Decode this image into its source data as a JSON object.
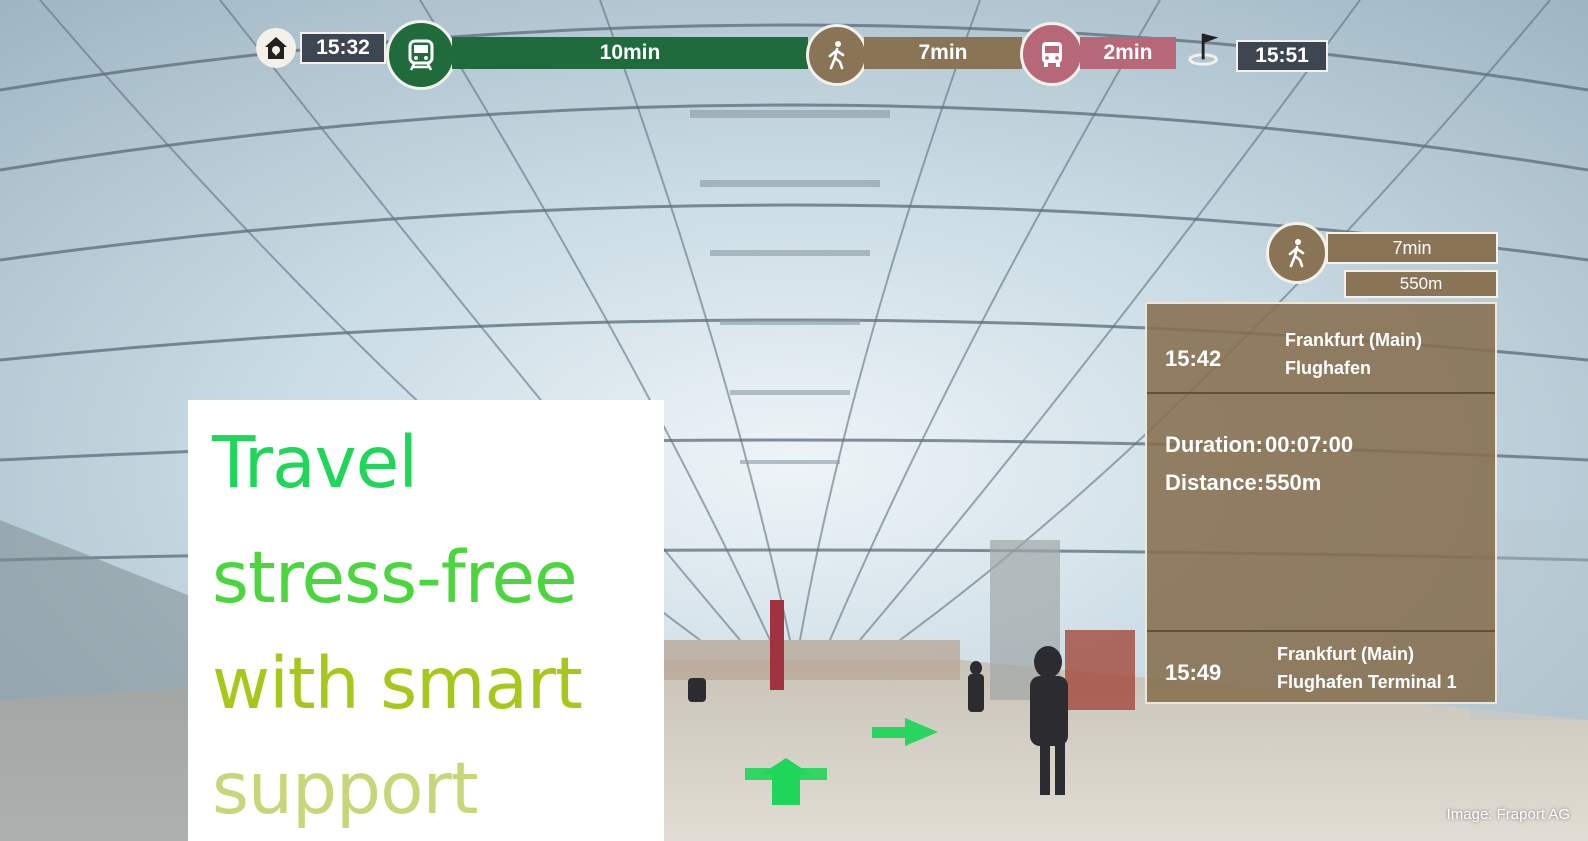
{
  "journey_bar": {
    "start_time": "15:32",
    "train_duration": "10min",
    "walk_duration": "7min",
    "bus_duration": "2min",
    "end_time": "15:51"
  },
  "walk_panel": {
    "walk_time": "7min",
    "walk_distance": "550m",
    "departure_time": "15:42",
    "departure_station_line1": "Frankfurt (Main)",
    "departure_station_line2": "Flughafen",
    "duration_label": "Duration:",
    "duration_value": "00:07:00",
    "distance_label": "Distance:",
    "distance_value": "550m",
    "arrival_time": "15:49",
    "arrival_station_line1": "Frankfurt (Main)",
    "arrival_station_line2": "Flughafen Terminal 1"
  },
  "headline": {
    "line1": "Travel",
    "line2": "stress-free",
    "line3": "with smart",
    "line4": "support"
  },
  "credit": "Image: Fraport AG",
  "colors": {
    "train": "#1f6b3c",
    "walk": "#8a7456",
    "bus": "#b76878",
    "headline1": "#1fd65a",
    "headline2": "#7ed321",
    "headline3": "#a6c81a",
    "headline4": "#c8d67a"
  }
}
